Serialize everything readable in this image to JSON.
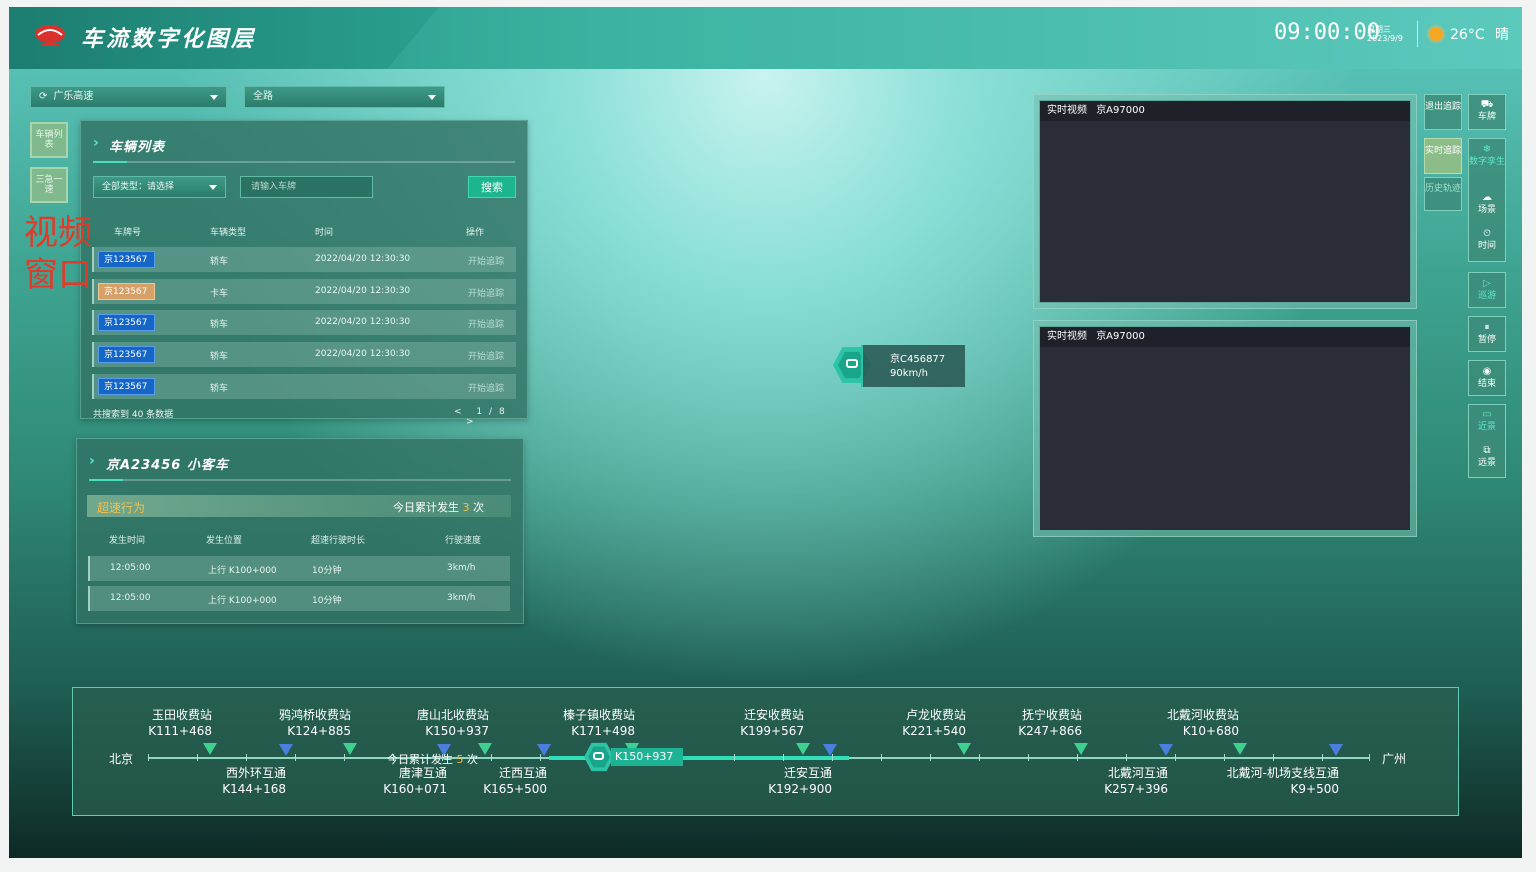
{
  "header": {
    "title": "车流数字化图层",
    "time": "09:00:00",
    "weekday": "星期三",
    "date": "2023/9/9",
    "temperature": "26°C",
    "weather": "晴"
  },
  "filters": {
    "road": "广乐高速",
    "scope": "全路"
  },
  "left_buttons": [
    "车辆列表",
    "三急一速"
  ],
  "overlay_text": [
    "视频",
    "窗口"
  ],
  "vehicle_list": {
    "title": "车辆列表",
    "type_select": "全部类型：请选择",
    "plate_placeholder": "请输入车牌",
    "search_label": "搜索",
    "columns": [
      "车牌号",
      "车辆类型",
      "时间",
      "操作"
    ],
    "rows": [
      {
        "plate": "京123567",
        "plate_color": "blue",
        "type": "轿车",
        "time": "2022/04/20 12:30:30",
        "action": "开始追踪"
      },
      {
        "plate": "京123567",
        "plate_color": "yellow",
        "type": "卡车",
        "time": "2022/04/20 12:30:30",
        "action": "开始追踪"
      },
      {
        "plate": "京123567",
        "plate_color": "blue",
        "type": "轿车",
        "time": "2022/04/20 12:30:30",
        "action": "开始追踪"
      },
      {
        "plate": "京123567",
        "plate_color": "blue",
        "type": "轿车",
        "time": "2022/04/20 12:30:30",
        "action": "开始追踪"
      },
      {
        "plate": "京123567",
        "plate_color": "blue",
        "type": "轿车",
        "time": "",
        "action": "开始追踪"
      }
    ],
    "total_text": "共搜索到 40 条数据",
    "pagination": {
      "prev": "<",
      "current": "1",
      "sep": "/",
      "total": "8",
      "next": ">"
    }
  },
  "vehicle_detail": {
    "title": "京A23456  小客车",
    "section": "超速行为",
    "today_prefix": "今日累计发生",
    "today_count": "3",
    "today_suffix": "次",
    "columns": [
      "发生时间",
      "发生位置",
      "超速行驶时长",
      "行驶速度"
    ],
    "rows": [
      {
        "time": "12:05:00",
        "location": "上行 K100+000",
        "duration": "10分钟",
        "speed": "3km/h"
      },
      {
        "time": "12:05:00",
        "location": "上行 K100+000",
        "duration": "10分钟",
        "speed": "3km/h"
      }
    ]
  },
  "marker": {
    "plate": "京C456877",
    "speed": "90km/h"
  },
  "videos": [
    {
      "label": "实时视频",
      "plate": "京A97000"
    },
    {
      "label": "实时视频",
      "plate": "京A97000"
    }
  ],
  "track_buttons": {
    "exit": "退出追踪",
    "realtime": "实时追踪",
    "history": "历史轨迹"
  },
  "toolbar": {
    "plate": "车牌",
    "twin": "数字孪生",
    "scene": "场景",
    "time": "时间",
    "cruise": "巡游",
    "pause": "暂停",
    "end": "结束",
    "near": "近景",
    "far": "远景"
  },
  "road": {
    "start_city": "北京",
    "end_city": "广州",
    "today_prefix": "今日累计发生",
    "today_count": "5",
    "today_suffix": "次",
    "current_marker": "K150+937",
    "stations_top": [
      {
        "name": "玉田收费站",
        "km": "K111+468"
      },
      {
        "name": "鸦鸿桥收费站",
        "km": "K124+885"
      },
      {
        "name": "唐山北收费站",
        "km": "K150+937"
      },
      {
        "name": "榛子镇收费站",
        "km": "K171+498"
      },
      {
        "name": "迁安收费站",
        "km": "K199+567"
      },
      {
        "name": "卢龙收费站",
        "km": "K221+540"
      },
      {
        "name": "抚宁收费站",
        "km": "K247+866"
      },
      {
        "name": "北戴河收费站",
        "km": "K10+680"
      }
    ],
    "stations_bottom": [
      {
        "name": "西外环互通",
        "km": "K144+168"
      },
      {
        "name": "唐津互通",
        "km": "K160+071"
      },
      {
        "name": "迁西互通",
        "km": "K165+500"
      },
      {
        "name": "迁安互通",
        "km": "K192+900"
      },
      {
        "name": "北戴河互通",
        "km": "K257+396"
      },
      {
        "name": "北戴河-机场支线互通",
        "km": "K9+500"
      }
    ]
  }
}
